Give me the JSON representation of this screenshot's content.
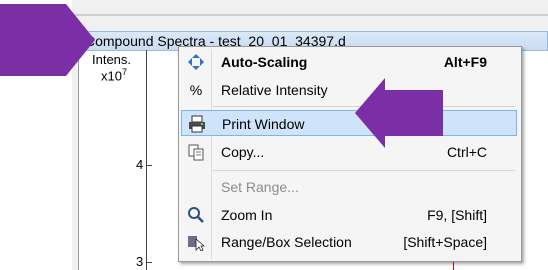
{
  "window": {
    "title": "Compound Spectra - test_20_01_34397.d"
  },
  "plot": {
    "y_axis_label": "Intens.",
    "y_axis_exponent_base": "x10",
    "y_axis_exponent": "7",
    "tick_labels": [
      "4",
      "3"
    ]
  },
  "context_menu": {
    "items": [
      {
        "label": "Auto-Scaling",
        "shortcut": "Alt+F9",
        "icon": "auto-scaling-icon"
      },
      {
        "label": "Relative Intensity",
        "shortcut": "",
        "icon": "percent-icon",
        "icon_glyph": "%"
      },
      {
        "label": "Print Window",
        "shortcut": "",
        "icon": "printer-icon"
      },
      {
        "label": "Copy...",
        "shortcut": "Ctrl+C",
        "icon": "copy-icon"
      },
      {
        "label": "Set Range...",
        "shortcut": "",
        "icon": ""
      },
      {
        "label": "Zoom In",
        "shortcut": "F9, [Shift]",
        "icon": "magnifier-icon"
      },
      {
        "label": "Range/Box Selection",
        "shortcut": "[Shift+Space]",
        "icon": "range-selection-icon"
      }
    ]
  },
  "colors": {
    "annotation_arrow": "#7a2fa6",
    "menu_highlight": "#cfe4fb",
    "plot_marker_line": "#e00000"
  }
}
